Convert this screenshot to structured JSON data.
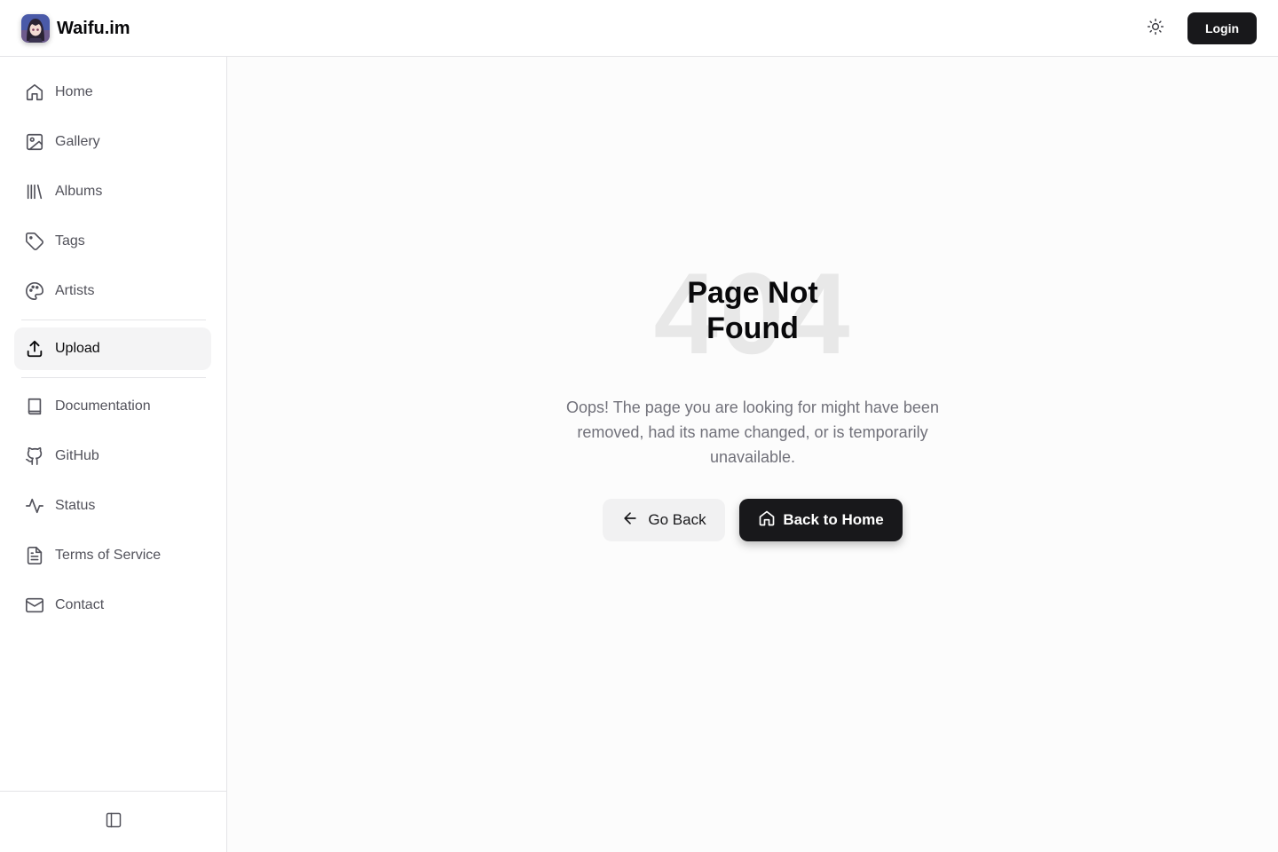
{
  "header": {
    "brand": "Waifu.im",
    "login_label": "Login"
  },
  "sidebar": {
    "items": [
      {
        "label": "Home",
        "icon": "home-icon"
      },
      {
        "label": "Gallery",
        "icon": "image-icon"
      },
      {
        "label": "Albums",
        "icon": "library-icon"
      },
      {
        "label": "Tags",
        "icon": "tag-icon"
      },
      {
        "label": "Artists",
        "icon": "palette-icon"
      },
      {
        "label": "Upload",
        "icon": "upload-icon",
        "active": true
      },
      {
        "label": "Documentation",
        "icon": "book-icon"
      },
      {
        "label": "GitHub",
        "icon": "github-icon"
      },
      {
        "label": "Status",
        "icon": "activity-icon"
      },
      {
        "label": "Terms of Service",
        "icon": "file-text-icon"
      },
      {
        "label": "Contact",
        "icon": "mail-icon"
      }
    ]
  },
  "main": {
    "background_code": "404",
    "title_line1": "Page Not",
    "title_line2": "Found",
    "description": "Oops! The page you are looking for might have been removed, had its name changed, or is temporarily unavailable.",
    "go_back_label": "Go Back",
    "home_label": "Back to Home"
  },
  "colors": {
    "primary": "#18181b",
    "muted_text": "#71717a",
    "border": "#e4e4e7",
    "active_bg": "#f4f4f5"
  }
}
